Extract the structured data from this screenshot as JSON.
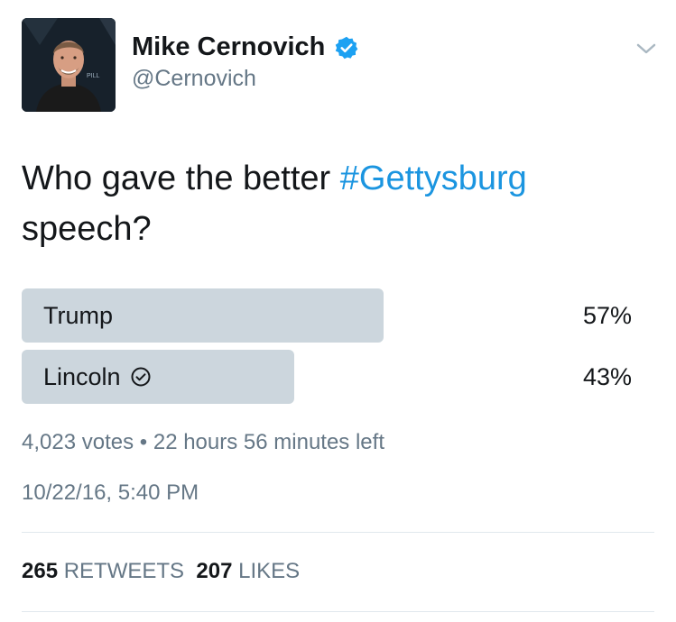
{
  "author": {
    "name": "Mike Cernovich",
    "handle": "@Cernovich",
    "verified": true,
    "avatar_backdrop_text": "PILL"
  },
  "tweet": {
    "text_before": "Who gave the better ",
    "hashtag": "#Gettysburg",
    "text_after": " speech?"
  },
  "poll": {
    "options": [
      {
        "label": "Trump",
        "percent_label": "57%",
        "percent": 57,
        "winner": false
      },
      {
        "label": "Lincoln",
        "percent_label": "43%",
        "percent": 43,
        "winner": true
      }
    ],
    "votes": "4,023 votes",
    "separator": "•",
    "time_left": "22 hours 56 minutes left"
  },
  "timestamp": "10/22/16, 5:40 PM",
  "stats": {
    "retweets_count": "265",
    "retweets_label": "RETWEETS",
    "likes_count": "207",
    "likes_label": "LIKES"
  },
  "colors": {
    "link": "#1b95e0",
    "poll_bar": "#ccd6dd",
    "secondary_text": "#657786",
    "verified_badge": "#1da1f2"
  },
  "icons": {
    "verified": "verified-badge-icon",
    "menu": "chevron-down-icon",
    "selected_option": "check-circle-icon"
  }
}
